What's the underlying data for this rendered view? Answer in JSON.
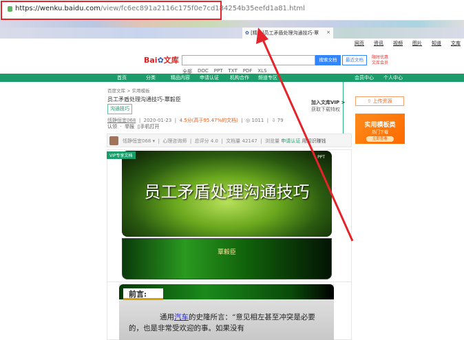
{
  "browser": {
    "url_host": "https://wenku.baidu.com",
    "url_path": "/view/fc6ec891a2116c175f0e7cd184254b35eefd1a81.html",
    "tab_title": "[精品]员工矛盾处理沟通技巧-覃",
    "tab_close": "×"
  },
  "toplinks": [
    "网页",
    "资讯",
    "视频",
    "图片",
    "知道",
    "文库"
  ],
  "header": {
    "logo_text": "Bai",
    "logo_suffix": "文库",
    "search_button": "搜索文档",
    "secondary_button": "最近文档",
    "promo": "限时优惠 文库会员",
    "filters": [
      "全部",
      "DOC",
      "PPT",
      "TXT",
      "PDF",
      "XLS"
    ]
  },
  "nav": {
    "items": [
      "首页",
      "分类",
      "精品内容",
      "申请认证",
      "机构合作",
      "频道专区"
    ],
    "right": [
      "会员中心",
      "个人中心"
    ]
  },
  "doc": {
    "breadcrumb": "百度文库 > 实用模板",
    "title": "员工矛盾处理沟通技巧-覃毅臣",
    "tag": "沟通技巧",
    "author": "恬静恒宜068",
    "date": "2020-01-23",
    "rating": "4.5分(高于95.47%的文档)",
    "views": "1011",
    "downloads": "79",
    "line2": [
      "认领",
      "举报",
      "手机打开"
    ]
  },
  "authorbar": {
    "name": "恬静恒宜068",
    "role": "心理咨询师",
    "score": "总评分 4.0",
    "docs": "文档量 42147",
    "extra": "浏览量",
    "apply": "申请认证",
    "use": "用知识赚钱"
  },
  "sidebar": {
    "vip_title": "加入文库VIP >",
    "vip_sub": "获取下载特权",
    "upload": "上传资源",
    "ad_title": "实用模板类",
    "ad_sub": "热门下载",
    "ad_button": "立即查看"
  },
  "slides": {
    "vip_badge": "VIP专享文档",
    "title": "员工矛盾处理沟通技巧",
    "logo": "PPT",
    "presenter": "覃毅臣",
    "preface": "前言:",
    "body_pre": "通用",
    "body_link": "汽车",
    "body_post": "的史隆所言：“意见相左甚至冲突是必要的，也是非常受欢迎的事。如果没有"
  }
}
